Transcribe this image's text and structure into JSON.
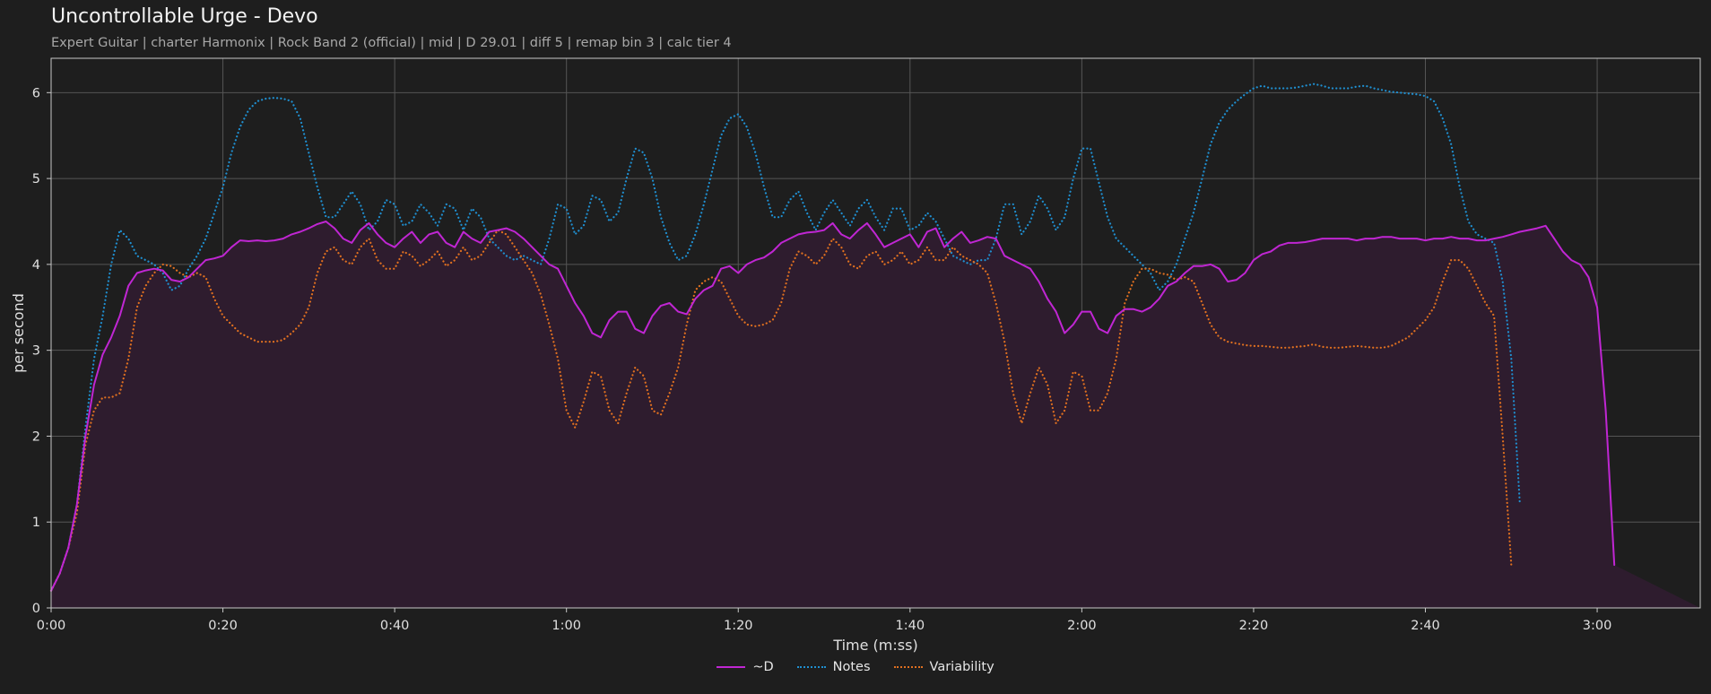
{
  "chart_data": {
    "type": "area",
    "title": "Uncontrollable Urge - Devo",
    "subtitle": "Expert Guitar  |  charter Harmonix  |  Rock Band 2 (official)  |  mid  |  D 29.01  |  diff 5  |  remap bin 3  |  calc tier 4",
    "xlabel": "Time (m:ss)",
    "ylabel": "per second",
    "xlim": [
      0,
      192
    ],
    "ylim": [
      0,
      6.4
    ],
    "xticks": [
      0,
      20,
      40,
      60,
      80,
      100,
      120,
      140,
      160,
      180
    ],
    "xtick_labels": [
      "0:00",
      "0:20",
      "0:40",
      "1:00",
      "1:20",
      "1:40",
      "2:00",
      "2:20",
      "2:40",
      "3:00"
    ],
    "yticks": [
      0,
      1,
      2,
      3,
      4,
      5,
      6
    ],
    "grid": true,
    "legend_position": "bottom-center",
    "x": [
      0,
      1,
      2,
      3,
      4,
      5,
      6,
      7,
      8,
      9,
      10,
      11,
      12,
      13,
      14,
      15,
      16,
      17,
      18,
      19,
      20,
      21,
      22,
      23,
      24,
      25,
      26,
      27,
      28,
      29,
      30,
      31,
      32,
      33,
      34,
      35,
      36,
      37,
      38,
      39,
      40,
      41,
      42,
      43,
      44,
      45,
      46,
      47,
      48,
      49,
      50,
      51,
      52,
      53,
      54,
      55,
      56,
      57,
      58,
      59,
      60,
      61,
      62,
      63,
      64,
      65,
      66,
      67,
      68,
      69,
      70,
      71,
      72,
      73,
      74,
      75,
      76,
      77,
      78,
      79,
      80,
      81,
      82,
      83,
      84,
      85,
      86,
      87,
      88,
      89,
      90,
      91,
      92,
      93,
      94,
      95,
      96,
      97,
      98,
      99,
      100,
      101,
      102,
      103,
      104,
      105,
      106,
      107,
      108,
      109,
      110,
      111,
      112,
      113,
      114,
      115,
      116,
      117,
      118,
      119,
      120,
      121,
      122,
      123,
      124,
      125,
      126,
      127,
      128,
      129,
      130,
      131,
      132,
      133,
      134,
      135,
      136,
      137,
      138,
      139,
      140,
      141,
      142,
      143,
      144,
      145,
      146,
      147,
      148,
      149,
      150,
      151,
      152,
      153,
      154,
      155,
      156,
      157,
      158,
      159,
      160,
      161,
      162,
      163,
      164,
      165,
      166,
      167,
      168,
      169,
      170,
      171,
      172,
      173,
      174,
      175,
      176,
      177,
      178,
      179,
      180,
      181,
      182,
      183,
      184,
      185,
      186,
      187,
      188,
      189,
      190,
      191,
      192
    ],
    "series": [
      {
        "name": "~D",
        "color": "#c026d3",
        "style": "solid",
        "fill": "#2e1c2e",
        "values": [
          0.2,
          0.4,
          0.7,
          1.2,
          2.0,
          2.6,
          2.95,
          3.15,
          3.4,
          3.75,
          3.9,
          3.93,
          3.95,
          3.93,
          3.82,
          3.8,
          3.85,
          3.95,
          4.05,
          4.07,
          4.1,
          4.2,
          4.28,
          4.27,
          4.28,
          4.27,
          4.28,
          4.3,
          4.35,
          4.38,
          4.42,
          4.47,
          4.5,
          4.42,
          4.3,
          4.25,
          4.4,
          4.48,
          4.35,
          4.25,
          4.2,
          4.3,
          4.38,
          4.25,
          4.35,
          4.38,
          4.25,
          4.2,
          4.38,
          4.3,
          4.25,
          4.38,
          4.4,
          4.42,
          4.38,
          4.3,
          4.2,
          4.1,
          4.0,
          3.95,
          3.75,
          3.55,
          3.4,
          3.2,
          3.15,
          3.35,
          3.45,
          3.45,
          3.25,
          3.2,
          3.4,
          3.52,
          3.55,
          3.45,
          3.42,
          3.6,
          3.7,
          3.75,
          3.95,
          3.98,
          3.9,
          4.0,
          4.05,
          4.08,
          4.15,
          4.25,
          4.3,
          4.35,
          4.37,
          4.38,
          4.4,
          4.48,
          4.35,
          4.3,
          4.4,
          4.48,
          4.35,
          4.2,
          4.25,
          4.3,
          4.35,
          4.2,
          4.38,
          4.42,
          4.2,
          4.3,
          4.38,
          4.25,
          4.28,
          4.32,
          4.3,
          4.1,
          4.05,
          4.0,
          3.95,
          3.8,
          3.6,
          3.45,
          3.2,
          3.3,
          3.45,
          3.45,
          3.25,
          3.2,
          3.4,
          3.48,
          3.48,
          3.45,
          3.5,
          3.6,
          3.75,
          3.8,
          3.9,
          3.98,
          3.98,
          4.0,
          3.95,
          3.8,
          3.82,
          3.9,
          4.05,
          4.12,
          4.15,
          4.22,
          4.25,
          4.25,
          4.26,
          4.28,
          4.3,
          4.3,
          4.3,
          4.3,
          4.28,
          4.3,
          4.3,
          4.32,
          4.32,
          4.3,
          4.3,
          4.3,
          4.28,
          4.3,
          4.3,
          4.32,
          4.3,
          4.3,
          4.28,
          4.28,
          4.3,
          4.32,
          4.35,
          4.38,
          4.4,
          4.42,
          4.45,
          4.3,
          4.15,
          4.05,
          4.0,
          3.85,
          3.5,
          2.3,
          0.5
        ]
      },
      {
        "name": "Notes",
        "color": "#1f8fd0",
        "style": "dotted",
        "values": [
          0.2,
          0.4,
          0.7,
          1.2,
          2.1,
          2.9,
          3.4,
          4.0,
          4.4,
          4.3,
          4.1,
          4.05,
          4.0,
          3.9,
          3.7,
          3.75,
          3.95,
          4.1,
          4.3,
          4.6,
          4.9,
          5.3,
          5.6,
          5.8,
          5.9,
          5.93,
          5.94,
          5.93,
          5.9,
          5.7,
          5.3,
          4.9,
          4.55,
          4.55,
          4.7,
          4.85,
          4.7,
          4.4,
          4.5,
          4.75,
          4.7,
          4.45,
          4.5,
          4.7,
          4.6,
          4.45,
          4.7,
          4.65,
          4.4,
          4.65,
          4.55,
          4.3,
          4.2,
          4.1,
          4.05,
          4.1,
          4.05,
          4.0,
          4.3,
          4.7,
          4.65,
          4.35,
          4.45,
          4.8,
          4.75,
          4.5,
          4.6,
          5.0,
          5.35,
          5.3,
          5.0,
          4.55,
          4.25,
          4.05,
          4.1,
          4.35,
          4.7,
          5.1,
          5.5,
          5.7,
          5.75,
          5.6,
          5.3,
          4.9,
          4.55,
          4.55,
          4.75,
          4.85,
          4.6,
          4.4,
          4.6,
          4.75,
          4.6,
          4.45,
          4.65,
          4.75,
          4.55,
          4.4,
          4.65,
          4.65,
          4.4,
          4.45,
          4.6,
          4.5,
          4.3,
          4.1,
          4.05,
          4.0,
          4.05,
          4.05,
          4.3,
          4.7,
          4.7,
          4.35,
          4.5,
          4.8,
          4.65,
          4.4,
          4.55,
          5.0,
          5.35,
          5.35,
          4.95,
          4.55,
          4.3,
          4.2,
          4.1,
          4.0,
          3.9,
          3.7,
          3.8,
          4.0,
          4.3,
          4.6,
          5.0,
          5.4,
          5.65,
          5.8,
          5.9,
          5.98,
          6.05,
          6.08,
          6.05,
          6.05,
          6.05,
          6.06,
          6.08,
          6.1,
          6.08,
          6.05,
          6.05,
          6.05,
          6.07,
          6.08,
          6.05,
          6.03,
          6.01,
          6.0,
          5.99,
          5.98,
          5.96,
          5.9,
          5.7,
          5.4,
          4.9,
          4.5,
          4.35,
          4.3,
          4.25,
          3.8,
          2.9,
          1.2
        ]
      },
      {
        "name": "Variability",
        "color": "#e07020",
        "style": "dotted",
        "values": [
          0.2,
          0.4,
          0.7,
          1.1,
          1.9,
          2.3,
          2.45,
          2.45,
          2.5,
          2.9,
          3.5,
          3.75,
          3.9,
          4.0,
          3.98,
          3.9,
          3.85,
          3.9,
          3.85,
          3.6,
          3.4,
          3.3,
          3.2,
          3.15,
          3.1,
          3.1,
          3.1,
          3.12,
          3.2,
          3.3,
          3.5,
          3.9,
          4.15,
          4.2,
          4.05,
          4.0,
          4.2,
          4.3,
          4.05,
          3.95,
          3.95,
          4.15,
          4.1,
          3.98,
          4.05,
          4.15,
          3.98,
          4.05,
          4.2,
          4.05,
          4.1,
          4.25,
          4.4,
          4.35,
          4.2,
          4.05,
          3.9,
          3.65,
          3.3,
          2.9,
          2.3,
          2.1,
          2.4,
          2.75,
          2.7,
          2.3,
          2.15,
          2.5,
          2.8,
          2.7,
          2.3,
          2.25,
          2.5,
          2.8,
          3.3,
          3.7,
          3.8,
          3.85,
          3.8,
          3.6,
          3.4,
          3.3,
          3.28,
          3.3,
          3.35,
          3.55,
          3.95,
          4.15,
          4.1,
          4.0,
          4.1,
          4.3,
          4.2,
          4.0,
          3.95,
          4.1,
          4.15,
          4.0,
          4.05,
          4.15,
          4.0,
          4.05,
          4.2,
          4.05,
          4.05,
          4.2,
          4.1,
          4.05,
          4.0,
          3.9,
          3.55,
          3.1,
          2.5,
          2.15,
          2.5,
          2.8,
          2.6,
          2.15,
          2.3,
          2.75,
          2.7,
          2.3,
          2.3,
          2.5,
          2.9,
          3.55,
          3.8,
          3.95,
          3.95,
          3.9,
          3.88,
          3.82,
          3.85,
          3.8,
          3.55,
          3.3,
          3.15,
          3.1,
          3.08,
          3.06,
          3.05,
          3.05,
          3.04,
          3.03,
          3.03,
          3.04,
          3.05,
          3.07,
          3.04,
          3.03,
          3.03,
          3.04,
          3.05,
          3.04,
          3.03,
          3.03,
          3.05,
          3.1,
          3.15,
          3.25,
          3.35,
          3.5,
          3.8,
          4.05,
          4.05,
          3.95,
          3.75,
          3.55,
          3.4,
          2.0,
          0.5
        ]
      }
    ]
  }
}
